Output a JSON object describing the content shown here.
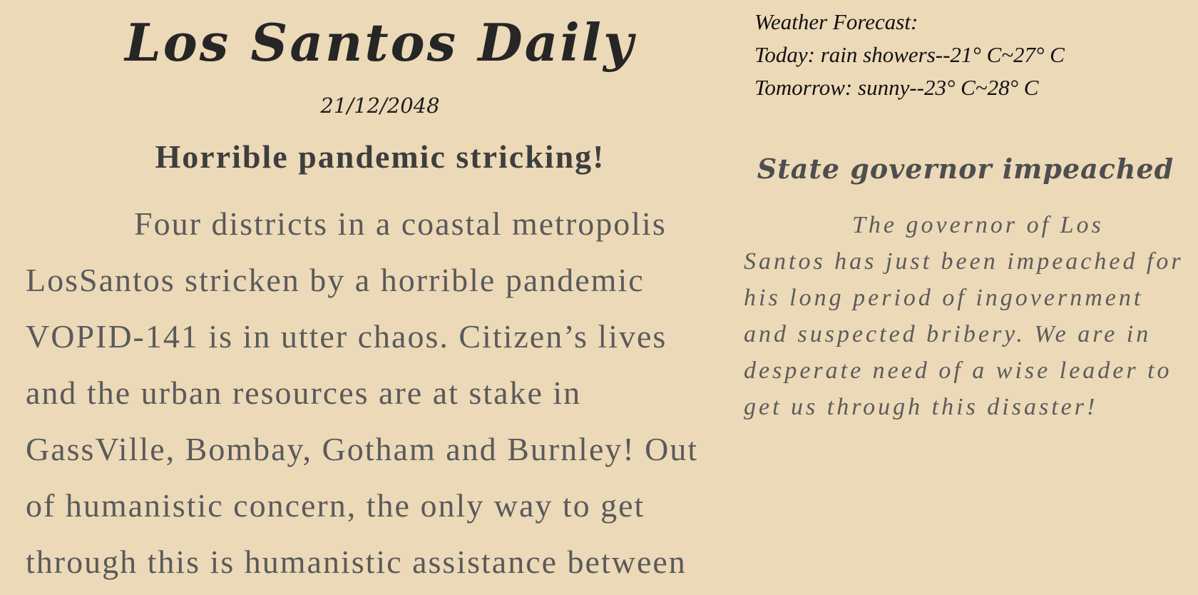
{
  "newspaper": {
    "title": "Los Santos Daily",
    "date": "21/12/2048"
  },
  "weather": {
    "heading": "Weather Forecast:",
    "today": "Today: rain showers--21° C~27° C",
    "tomorrow": "Tomorrow: sunny--23° C~28° C"
  },
  "main_story": {
    "headline": "Horrible pandemic stricking!",
    "body": "Four districts in a coastal metropolis\nLosSantos stricken by a horrible pandemic\nVOPID-141 is in utter chaos. Citizen’s lives\nand the urban resources are at stake in\nGassVille, Bombay, Gotham and Burnley! Out\nof humanistic concern, the only way to get\nthrough this is humanistic assistance between"
  },
  "side_story": {
    "headline": "State governor impeached",
    "body": "The governor of Los\nSantos has just been impeached for\nhis long period of ingovernment\nand suspected bribery. We are in\ndesperate need of a wise leader to\nget us through this disaster!"
  }
}
